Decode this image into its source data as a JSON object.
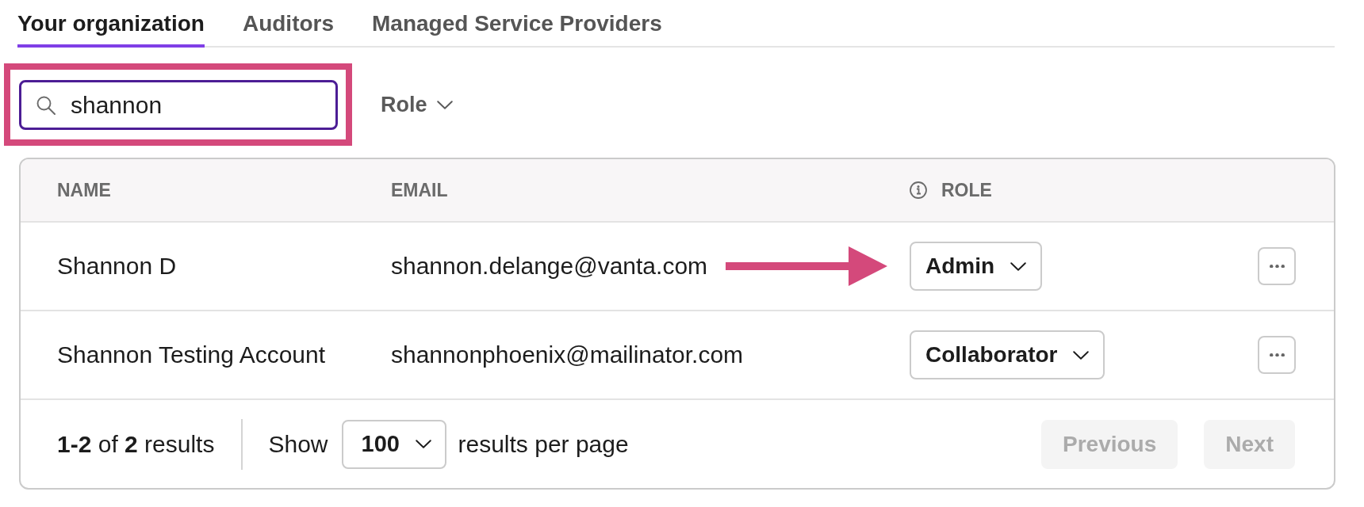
{
  "tabs": [
    {
      "label": "Your organization",
      "selected": true
    },
    {
      "label": "Auditors",
      "selected": false
    },
    {
      "label": "Managed Service Providers",
      "selected": false
    }
  ],
  "filters": {
    "search": {
      "value": "shannon",
      "highlighted": true
    },
    "role_filter": {
      "label": "Role"
    }
  },
  "table": {
    "columns": [
      {
        "label": "NAME",
        "info": false
      },
      {
        "label": "EMAIL",
        "info": false
      },
      {
        "label": "ROLE",
        "info": true
      }
    ],
    "rows": [
      {
        "name": "Shannon D",
        "email": "shannon.delange@vanta.com",
        "role": "Admin",
        "arrow": true
      },
      {
        "name": "Shannon Testing Account",
        "email": "shannonphoenix@mailinator.com",
        "role": "Collaborator",
        "arrow": false
      }
    ]
  },
  "pagination": {
    "summary": "**1-2** of **2** results",
    "show_label": "Show",
    "page_size": "100",
    "per_page_label": "results per page",
    "buttons": [
      {
        "label": "Previous",
        "disabled": true
      },
      {
        "label": "Next",
        "disabled": true
      }
    ]
  }
}
